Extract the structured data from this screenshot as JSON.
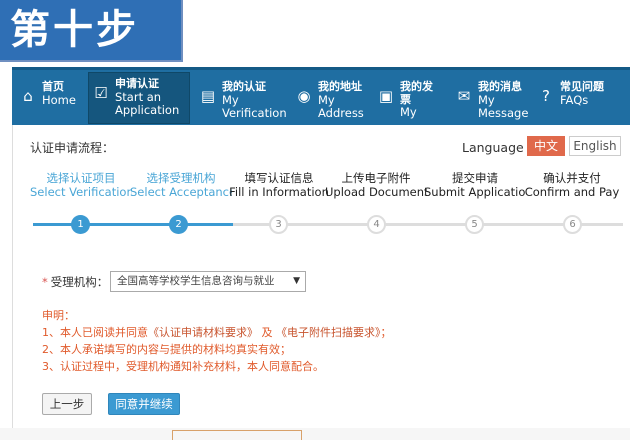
{
  "banner": {
    "text": "第十步"
  },
  "nav": {
    "items": [
      {
        "zh": "首页",
        "en": "Home",
        "icon": "home-icon"
      },
      {
        "zh": "申请认证",
        "en": "Start an Application",
        "icon": "checkbox-icon"
      },
      {
        "zh": "我的认证",
        "en": "My Verification",
        "icon": "certificate-icon"
      },
      {
        "zh": "我的地址",
        "en": "My Address",
        "icon": "location-pin-icon"
      },
      {
        "zh": "我的发票",
        "en": "My",
        "icon": "invoice-icon"
      },
      {
        "zh": "我的消息",
        "en": "My Message",
        "icon": "message-icon"
      },
      {
        "zh": "常见问题",
        "en": "FAQs",
        "icon": "help-icon"
      }
    ]
  },
  "process": {
    "title": "认证申请流程：",
    "language_label": "Language :",
    "lang_zh": "中文",
    "lang_en": "English",
    "steps": [
      {
        "zh": "选择认证项目",
        "en": "Select Verification Items",
        "num": "1"
      },
      {
        "zh": "选择受理机构",
        "en": "Select Acceptance Office",
        "num": "2"
      },
      {
        "zh": "填写认证信息",
        "en": "Fill in Information",
        "num": "3"
      },
      {
        "zh": "上传电子附件",
        "en": "Upload Documents",
        "num": "4"
      },
      {
        "zh": "提交申请",
        "en": "Submit Application",
        "num": "5"
      },
      {
        "zh": "确认并支付",
        "en": "Confirm and Pay",
        "num": "6"
      }
    ],
    "completed_steps": 2
  },
  "form": {
    "office_label": "受理机构：",
    "office_value": "全国高等学校学生信息咨询与就业"
  },
  "notice": {
    "heading": "申明：",
    "line1_prefix": "1、本人已阅读并同意",
    "line1_link1": "《认证申请材料要求》",
    "line1_mid": "及",
    "line1_link2": "《电子附件扫描要求》",
    "line1_suffix": "；",
    "line2": "2、本人承诺填写的内容与提供的材料均真实有效；",
    "line3": "3、认证过程中，受理机构通知补充材料，本人同意配合。"
  },
  "buttons": {
    "prev": "上一步",
    "next": "同意并继续"
  },
  "colors": {
    "nav_bg": "#1f6ea2",
    "accent": "#3b9ad2",
    "notice": "#e05a2b",
    "lang_active": "#e0694b"
  }
}
